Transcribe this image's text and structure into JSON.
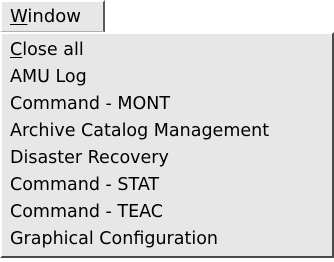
{
  "menubar": {
    "window_label_mnemonic": "W",
    "window_label_rest": "indow"
  },
  "menu": {
    "items": [
      {
        "mnemonic": "C",
        "label_rest": "lose all"
      },
      {
        "label": "AMU Log"
      },
      {
        "label": "Command - MONT"
      },
      {
        "label": "Archive Catalog Management"
      },
      {
        "label": "Disaster Recovery"
      },
      {
        "label": "Command - STAT"
      },
      {
        "label": "Command - TEAC"
      },
      {
        "label": "Graphical Configuration"
      }
    ]
  }
}
